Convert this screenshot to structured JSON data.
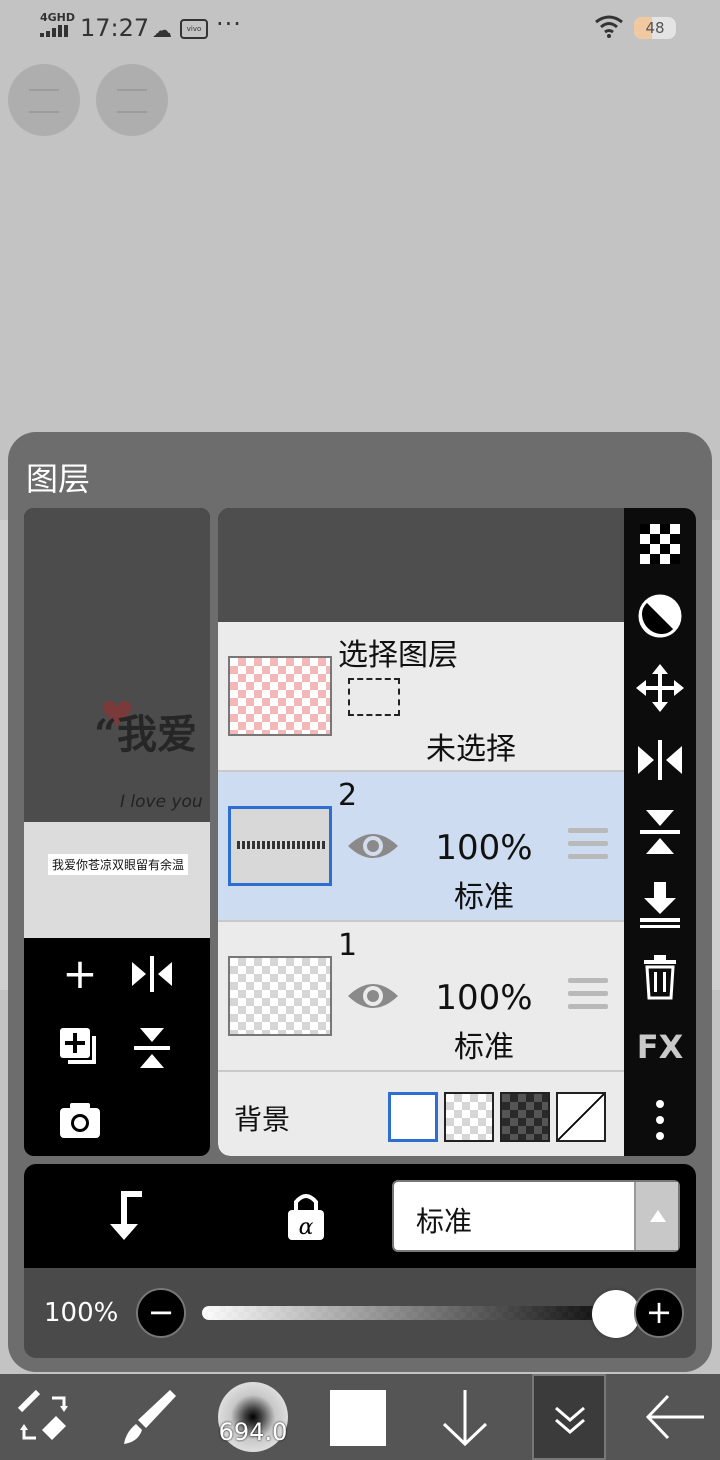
{
  "status_bar": {
    "network": "4GHD",
    "time": "17:27",
    "more": "···",
    "battery": "48"
  },
  "layer_panel": {
    "title": "图层",
    "preview": {
      "art_text": "“我爱",
      "script_text": "I love you",
      "caption_text": "我爱你苍凉双眼留有余温"
    },
    "selection_layer": {
      "title": "选择图层",
      "status": "未选择"
    },
    "layers": [
      {
        "number": "2",
        "opacity": "100%",
        "blend": "标准",
        "selected": true
      },
      {
        "number": "1",
        "opacity": "100%",
        "blend": "标准",
        "selected": false
      }
    ],
    "background": {
      "label": "背景",
      "options": [
        "white",
        "transparent",
        "dark-checker",
        "none"
      ],
      "selected": "white"
    },
    "right_tools": [
      "checker-icon",
      "invert-icon",
      "move-icon",
      "flip-horizontal-icon",
      "flip-vertical-icon",
      "merge-down-icon",
      "trash-icon",
      "fx-icon",
      "more-vertical-icon"
    ],
    "fx_label": "FX",
    "blend_mode": {
      "value": "标准"
    },
    "opacity": {
      "label": "100%",
      "value": 1.0
    }
  },
  "toolbar": {
    "brush_size": "694.0",
    "color": "#ffffff"
  },
  "colors": {
    "panel": "#6d6d6d",
    "selected_row": "#cddcf0",
    "accent": "#2d6fd1"
  }
}
